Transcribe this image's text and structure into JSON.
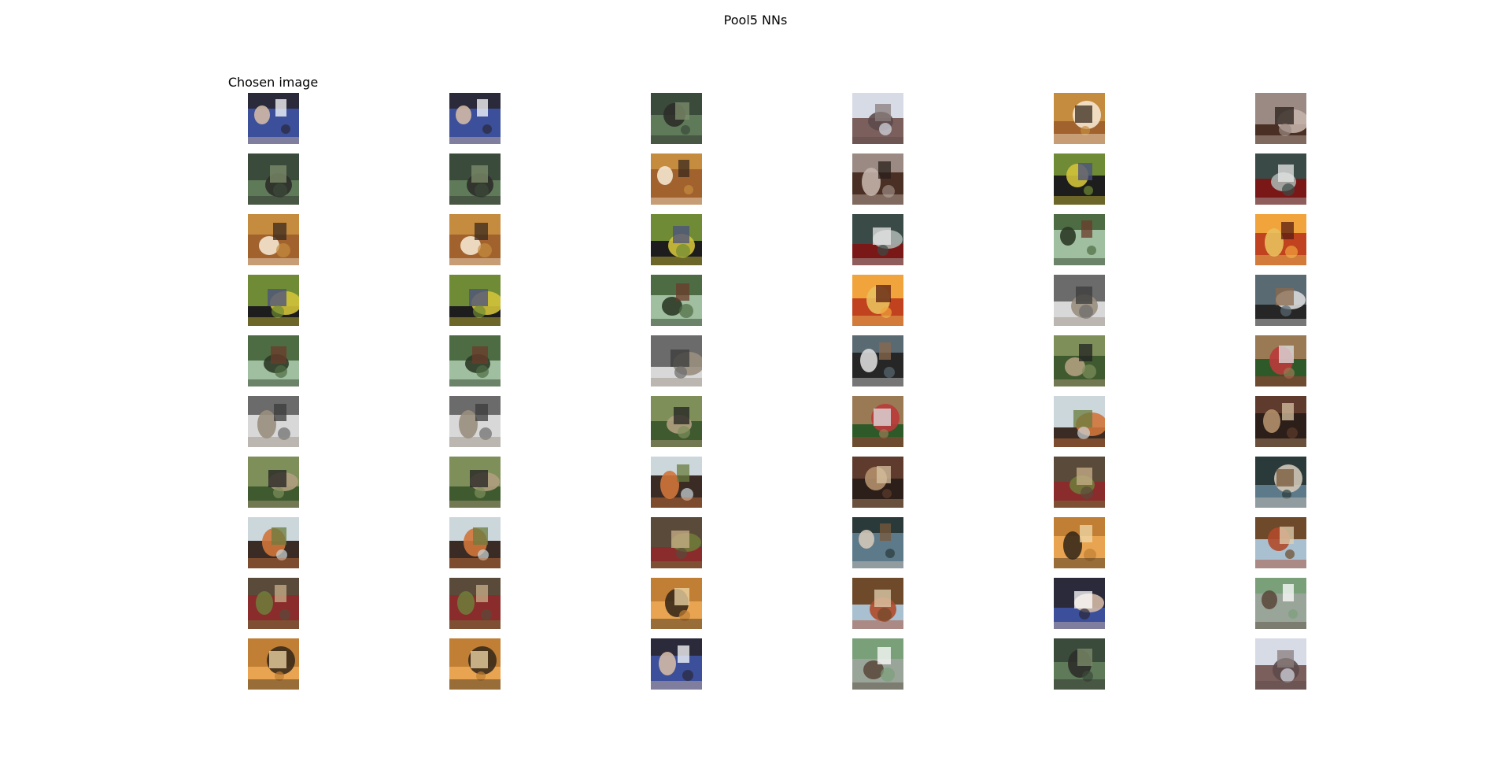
{
  "figure": {
    "title": "Pool5 NNs",
    "first_column_title": "Chosen image"
  },
  "grid": {
    "rows": 10,
    "columns": 6,
    "cells": [
      [
        "man-holding-dog-icon",
        "man-holding-dog-icon",
        "two-cats-icon",
        "people-indoors-icon",
        "two-people-dark-icon",
        "snarling-dog-icon"
      ],
      [
        "train-on-tracks-icon",
        "train-on-tracks-icon",
        "city-street-icon",
        "people-in-hall-icon",
        "bright-hallway-icon",
        "computer-desk-icon"
      ],
      [
        "green-building-icon",
        "green-building-icon",
        "bw-crowd-icon",
        "bw-vintage-car-icon",
        "field-with-goat-icon",
        "storefront-icon"
      ],
      [
        "brick-buildings-icon",
        "brick-buildings-icon",
        "owl-icon",
        "bw-hill-icon",
        "harbor-icon",
        "cat-on-blanket-icon"
      ],
      [
        "warm-room-icon",
        "warm-room-icon",
        "flower-garden-icon",
        "payphone-icon",
        "horse-jumping-icon",
        "orange-cat-icon"
      ],
      [
        "furniture-room-icon",
        "furniture-room-icon",
        "child-in-chair-icon",
        "two-women-icon",
        "cyclists-icon",
        "potted-plants-icon"
      ],
      [
        "horse-rider-jump-icon",
        "horse-rider-jump-icon",
        "horse-rider-jump-icon",
        "person-with-dogs-icon",
        "trees-and-path-icon",
        "dry-hillside-icon"
      ],
      [
        "dog-in-red-coat-icon",
        "dog-in-red-coat-icon",
        "person-red-jacket-icon",
        "bus-icon",
        "baby-icon",
        "husky-icon"
      ],
      [
        "cow-under-tree-icon",
        "cow-under-tree-icon",
        "forest-bench-icon",
        "dog-on-grass-icon",
        "river-aerial-icon",
        "rocky-animals-icon"
      ],
      [
        "taxi-street-night-icon",
        "taxi-street-night-icon",
        "food-table-icon",
        "food-plates-icon",
        "orchestra-hall-icon",
        "red-restaurant-icon"
      ]
    ],
    "palettes": [
      [
        "#2b2a3a",
        "#3b4f9b",
        "#d2b8a5",
        "#ffffff"
      ],
      [
        "#7aa07a",
        "#9aa59a",
        "#5c4b3d",
        "#ffffff"
      ],
      [
        "#3a4a3b",
        "#5e7a58",
        "#2d2d2a",
        "#7f8f6c"
      ],
      [
        "#d7dbe6",
        "#7a5f5c",
        "#5d4a4a",
        "#8a7d7c"
      ],
      [
        "#c58b3f",
        "#a1622d",
        "#f4e6cf",
        "#3a2a1e"
      ],
      [
        "#9b8a83",
        "#4a2f24",
        "#c3b3aa",
        "#2a1f1b"
      ],
      [
        "#6f8b35",
        "#1d1d1d",
        "#d1c23a",
        "#4a4f82"
      ],
      [
        "#3a4a46",
        "#7a1818",
        "#a9b1ae",
        "#e8e8e8"
      ],
      [
        "#4e6c43",
        "#9fbfa0",
        "#2b3a26",
        "#6b3b2a"
      ],
      [
        "#f2a43c",
        "#c0421f",
        "#e8c05c",
        "#5a1e12"
      ],
      [
        "#6b6b6b",
        "#d8d8d8",
        "#9a8f7e",
        "#3b3b3b"
      ],
      [
        "#5a6a72",
        "#262626",
        "#d9d9d9",
        "#8a6a4e"
      ],
      [
        "#7e8f5a",
        "#3f5a2f",
        "#b09e7e",
        "#222222"
      ],
      [
        "#9a7a54",
        "#2d5a28",
        "#bb3a3a",
        "#dde3e6"
      ],
      [
        "#ccd7dc",
        "#3a2c25",
        "#d0743a",
        "#6a7c3f"
      ],
      [
        "#5e3b2c",
        "#2c1e18",
        "#b38f6b",
        "#d8c3a1"
      ],
      [
        "#5a4a3a",
        "#8a2c2c",
        "#6f7a3a",
        "#c8b08a"
      ],
      [
        "#2a3a3a",
        "#5c7a8a",
        "#d0c6b8",
        "#7a5a3a"
      ],
      [
        "#c07f35",
        "#e8a450",
        "#3a2a1a",
        "#f0d8a8"
      ],
      [
        "#6e4a2a",
        "#a8c0d0",
        "#b04a2a",
        "#e0d0b0"
      ]
    ]
  }
}
